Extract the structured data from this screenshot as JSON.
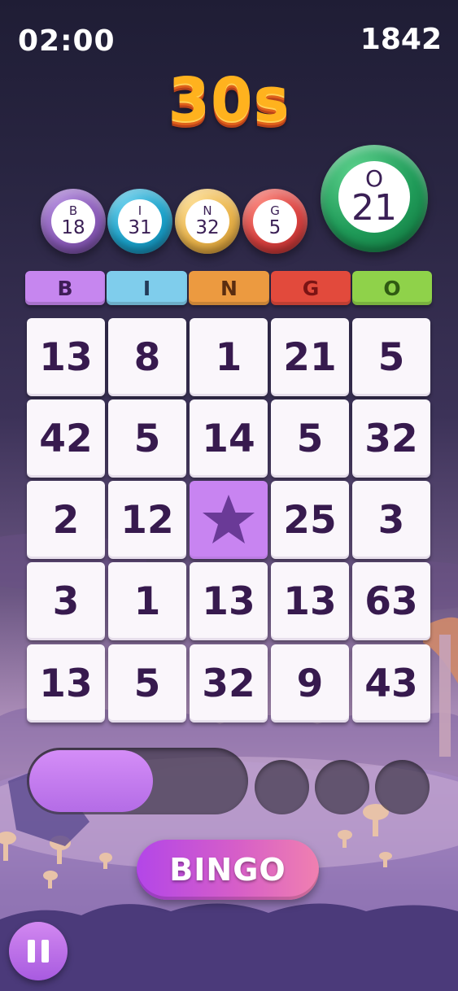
{
  "hud": {
    "timer": "02:00",
    "score": "1842"
  },
  "countdown": "30s",
  "called_balls": [
    {
      "letter": "B",
      "number": "18",
      "color": "#8a5bb8"
    },
    {
      "letter": "I",
      "number": "31",
      "color": "#1aa0c8"
    },
    {
      "letter": "N",
      "number": "32",
      "color": "#e9b34a"
    },
    {
      "letter": "G",
      "number": "5",
      "color": "#d8403e"
    }
  ],
  "current_ball": {
    "letter": "O",
    "number": "21",
    "color": "#1f9a58"
  },
  "headers": [
    {
      "label": "B",
      "bg": "#c686ef",
      "fg": "#3e1d57"
    },
    {
      "label": "I",
      "bg": "#7fcdec",
      "fg": "#233a58"
    },
    {
      "label": "N",
      "bg": "#ec9a40",
      "fg": "#5a2d10"
    },
    {
      "label": "G",
      "bg": "#e24a3c",
      "fg": "#7a1414"
    },
    {
      "label": "O",
      "bg": "#8fd24a",
      "fg": "#2f5a12"
    }
  ],
  "board": [
    [
      "13",
      "8",
      "1",
      "21",
      "5"
    ],
    [
      "42",
      "5",
      "14",
      "5",
      "32"
    ],
    [
      "2",
      "12",
      "★",
      "25",
      "3"
    ],
    [
      "3",
      "1",
      "13",
      "13",
      "63"
    ],
    [
      "13",
      "5",
      "32",
      "9",
      "43"
    ]
  ],
  "free_space": {
    "row": 2,
    "col": 2,
    "icon": "star-icon",
    "color": "#6a3a97"
  },
  "power_meter": {
    "fill_fraction": 0.57,
    "slots": 3
  },
  "bingo_button": {
    "label": "BINGO"
  },
  "pause_button": {
    "icon": "pause-icon"
  },
  "colors": {
    "accent": "#c884f1",
    "cell_text": "#371a4e",
    "countdown": "#ffb21e"
  }
}
